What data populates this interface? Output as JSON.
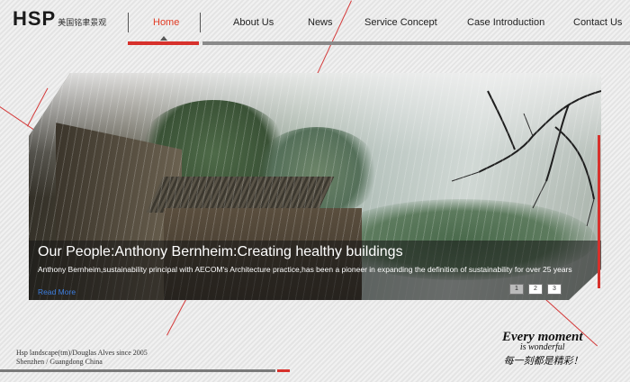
{
  "header": {
    "logo_main": "HSP",
    "logo_sub": "美国铭聿景观"
  },
  "nav": {
    "items": [
      {
        "label": "Home",
        "active": true
      },
      {
        "label": "About Us"
      },
      {
        "label": "News"
      },
      {
        "label": "Service Concept"
      },
      {
        "label": "Case Introduction"
      },
      {
        "label": "Contact Us"
      }
    ]
  },
  "banner": {
    "title": "Our People:Anthony Bernheim:Creating healthy buildings",
    "text": "Anthony Bernheim,sustainability principal with AECOM's Architecture practice,has been a pioneer in expanding the definition of sustainability for over 25 years",
    "read_more": "Read More",
    "pager": [
      "1",
      "2",
      "3"
    ],
    "active_slide": "1"
  },
  "footer": {
    "line1": "Hsp landscape(tm)/Douglas Alves since 2005",
    "line2": "Shenzhen / Guangdong China"
  },
  "slogan": {
    "line1": "Every moment",
    "line2": "is wonderful",
    "line3": "每一刻都是精彩！"
  },
  "colors": {
    "accent_red": "#d7312c",
    "nav_active": "#e23b24",
    "link_blue": "#3d7fe0"
  }
}
